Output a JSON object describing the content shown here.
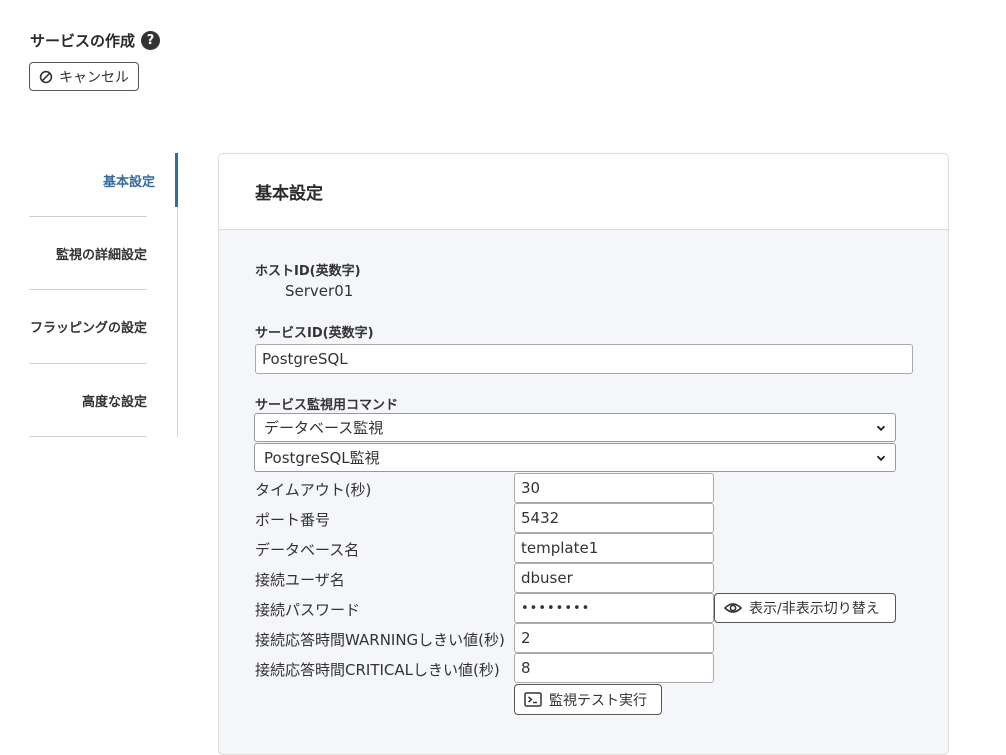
{
  "header": {
    "title": "サービスの作成",
    "help_icon": "question-circle-icon",
    "cancel_label": "キャンセル",
    "cancel_icon": "ban-icon"
  },
  "sidenav": {
    "items": [
      {
        "label": "基本設定",
        "active": true
      },
      {
        "label": "監視の詳細設定",
        "active": false
      },
      {
        "label": "フラッピングの設定",
        "active": false
      },
      {
        "label": "高度な設定",
        "active": false
      }
    ],
    "accent_color": "#3a6a9a"
  },
  "card": {
    "title": "基本設定",
    "host_id_label": "ホストID(英数字)",
    "host_id_value": "Server01",
    "service_id_label": "サービスID(英数字)",
    "service_id_value": "PostgreSQL",
    "command_label": "サービス監視用コマンド",
    "command_category": "データベース監視",
    "command_type": "PostgreSQL監視",
    "params": [
      {
        "label": "タイムアウト(秒)",
        "value": "30"
      },
      {
        "label": "ポート番号",
        "value": "5432"
      },
      {
        "label": "データベース名",
        "value": "template1"
      },
      {
        "label": "接続ユーザ名",
        "value": "dbuser"
      },
      {
        "label": "接続パスワード",
        "value": "••••••••"
      },
      {
        "label": "接続応答時間WARNINGしきい値(秒)",
        "value": "2"
      },
      {
        "label": "接続応答時間CRITICALしきい値(秒)",
        "value": "8"
      }
    ],
    "toggle_password_label": "表示/非表示切り替え",
    "toggle_password_icon": "eye-icon",
    "test_button_label": "監視テスト実行",
    "test_button_icon": "terminal-icon"
  }
}
